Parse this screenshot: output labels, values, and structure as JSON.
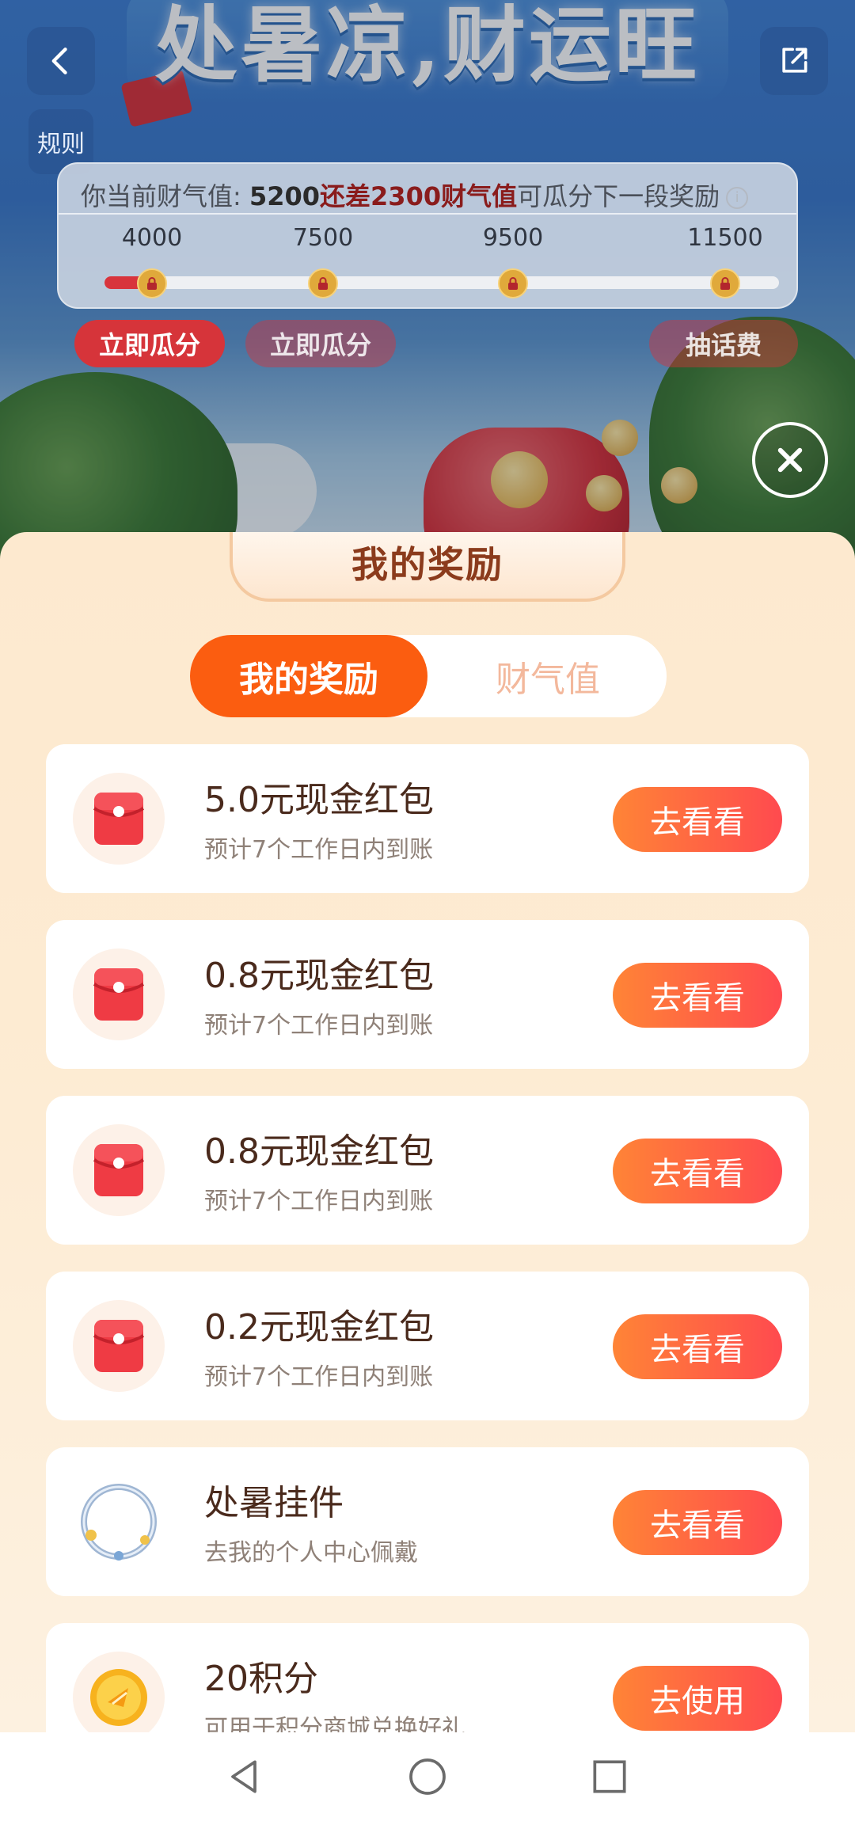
{
  "header": {
    "title": "处暑凉,财运旺",
    "back_icon": "back-arrow-icon",
    "share_icon": "share-icon",
    "rules_label": "规则"
  },
  "progress": {
    "prefix": "你当前财气值: ",
    "current_value": "5200",
    "gap_text": "还差2300财气值",
    "suffix": "可瓜分下一段奖励",
    "fill_fraction": 0.075,
    "milestones": [
      {
        "value": "4000",
        "button": "立即瓜分",
        "state": "active"
      },
      {
        "value": "7500",
        "button": "立即瓜分",
        "state": "muted"
      },
      {
        "value": "9500",
        "button": "",
        "state": "none"
      },
      {
        "value": "11500",
        "button": "抽话费",
        "state": "muted"
      }
    ]
  },
  "sheet": {
    "title": "我的奖励",
    "tabs": [
      {
        "label": "我的奖励",
        "active": true
      },
      {
        "label": "财气值",
        "active": false
      }
    ],
    "rewards": [
      {
        "icon": "red-envelope-icon",
        "title": "5.0元现金红包",
        "subtitle": "预计7个工作日内到账",
        "action": "去看看"
      },
      {
        "icon": "red-envelope-icon",
        "title": "0.8元现金红包",
        "subtitle": "预计7个工作日内到账",
        "action": "去看看"
      },
      {
        "icon": "red-envelope-icon",
        "title": "0.8元现金红包",
        "subtitle": "预计7个工作日内到账",
        "action": "去看看"
      },
      {
        "icon": "red-envelope-icon",
        "title": "0.2元现金红包",
        "subtitle": "预计7个工作日内到账",
        "action": "去看看"
      },
      {
        "icon": "avatar-frame-icon",
        "title": "处暑挂件",
        "subtitle": "去我的个人中心佩戴",
        "action": "去看看"
      },
      {
        "icon": "points-coin-icon",
        "title": "20积分",
        "subtitle": "可用于积分商城兑换好礼",
        "action": "去使用"
      }
    ]
  },
  "colors": {
    "accent": "#fb5d10",
    "progress_red": "#d8343c",
    "button_gradient_start": "#ff8436",
    "button_gradient_end": "#ff4a4f"
  },
  "navbar": {
    "icons": [
      "nav-back-icon",
      "nav-home-icon",
      "nav-recents-icon"
    ]
  }
}
